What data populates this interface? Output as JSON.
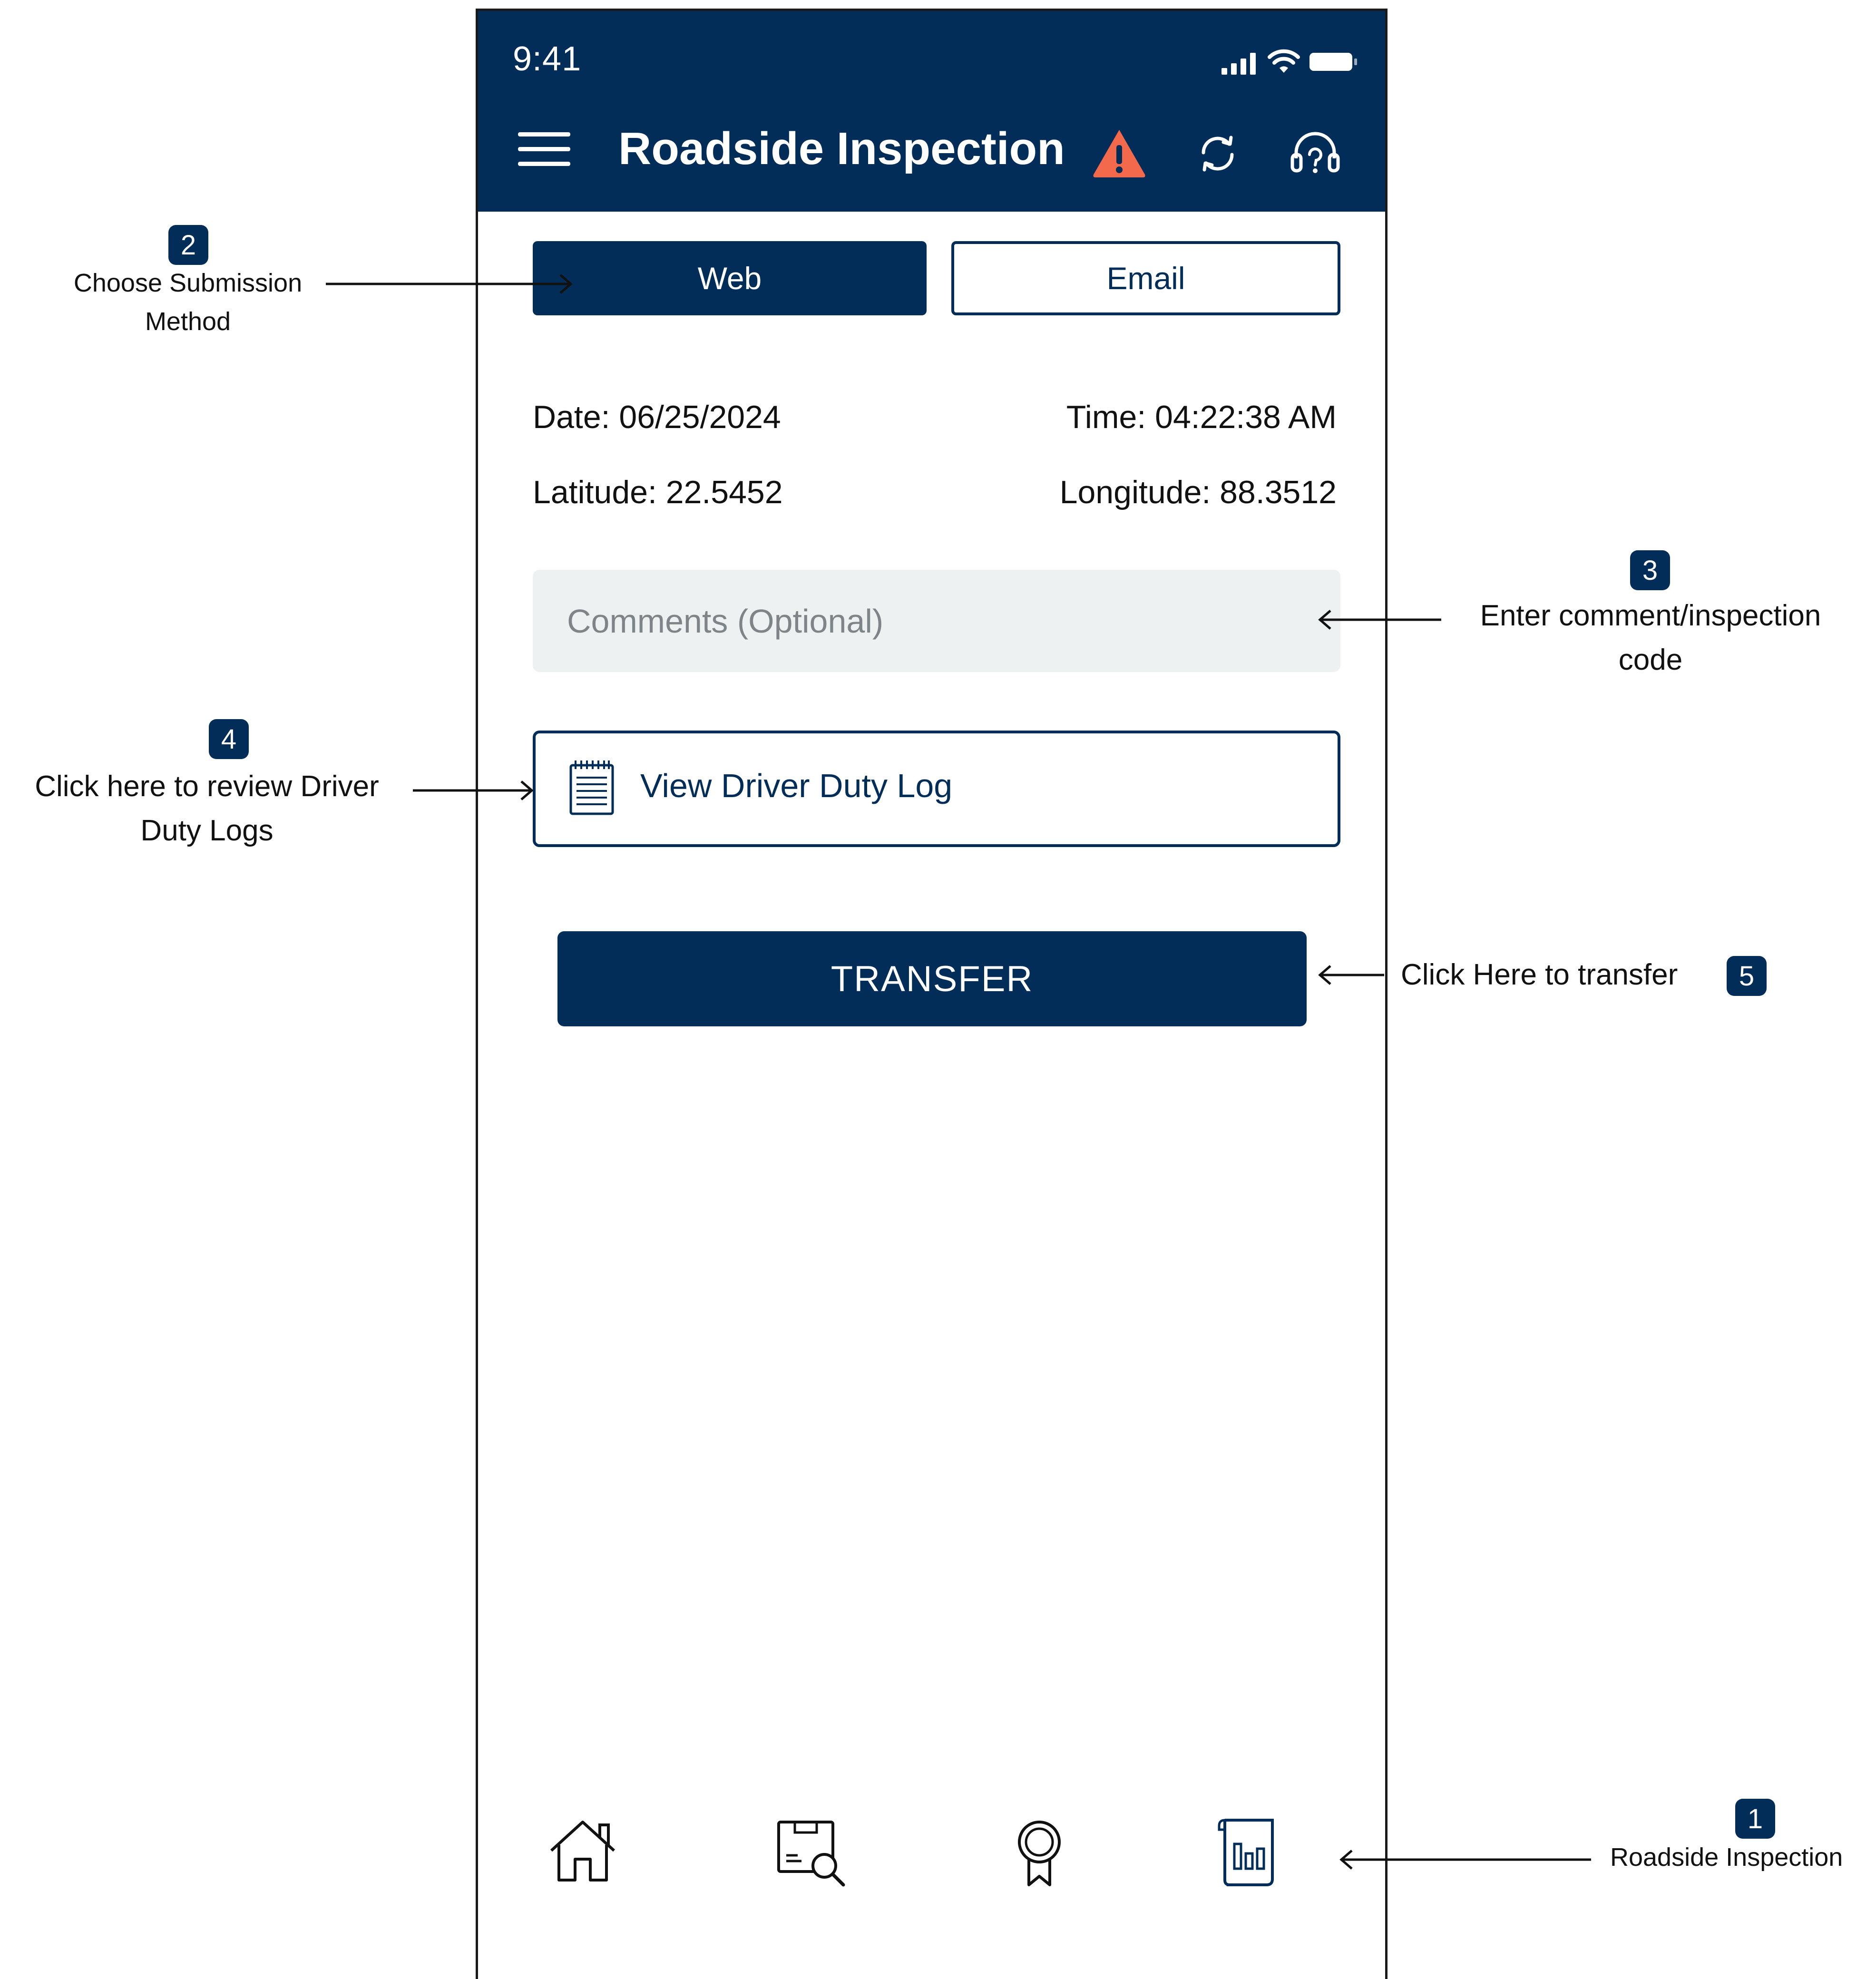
{
  "status_bar": {
    "time": "9:41"
  },
  "header": {
    "title": "Roadside Inspection",
    "icons": [
      "menu-icon",
      "warning-icon",
      "sync-icon",
      "headset-icon"
    ],
    "warning_color": "#f26a4b"
  },
  "tabs": [
    {
      "label": "Web",
      "selected": true
    },
    {
      "label": "Email",
      "selected": false
    }
  ],
  "info": {
    "date": "Date: 06/25/2024",
    "time": "Time: 04:22:38 AM",
    "latitude": "Latitude: 22.5452",
    "longitude": "Longitude: 88.3512"
  },
  "comments": {
    "placeholder": "Comments (Optional)",
    "value": ""
  },
  "duty_log": {
    "label": "View Driver Duty Log",
    "icon": "document-icon"
  },
  "transfer": {
    "label": "TRANSFER"
  },
  "bottom_nav": {
    "items": [
      "home-icon",
      "document-search-icon",
      "award-icon",
      "report-scroll-icon"
    ]
  },
  "annotations": {
    "a1": {
      "number": "1",
      "text": "Roadside Inspection"
    },
    "a2": {
      "number": "2",
      "line1": "Choose Submission",
      "line2": "Method"
    },
    "a3": {
      "number": "3",
      "line1": "Enter comment/inspection",
      "line2": "code"
    },
    "a4": {
      "number": "4",
      "line1": "Click here to review Driver",
      "line2": "Duty Logs"
    },
    "a5": {
      "number": "5",
      "text": "Click Here to transfer"
    }
  },
  "colors": {
    "primary": "#022d59",
    "input_bg": "#edf1f1",
    "background": "#ffffff"
  }
}
